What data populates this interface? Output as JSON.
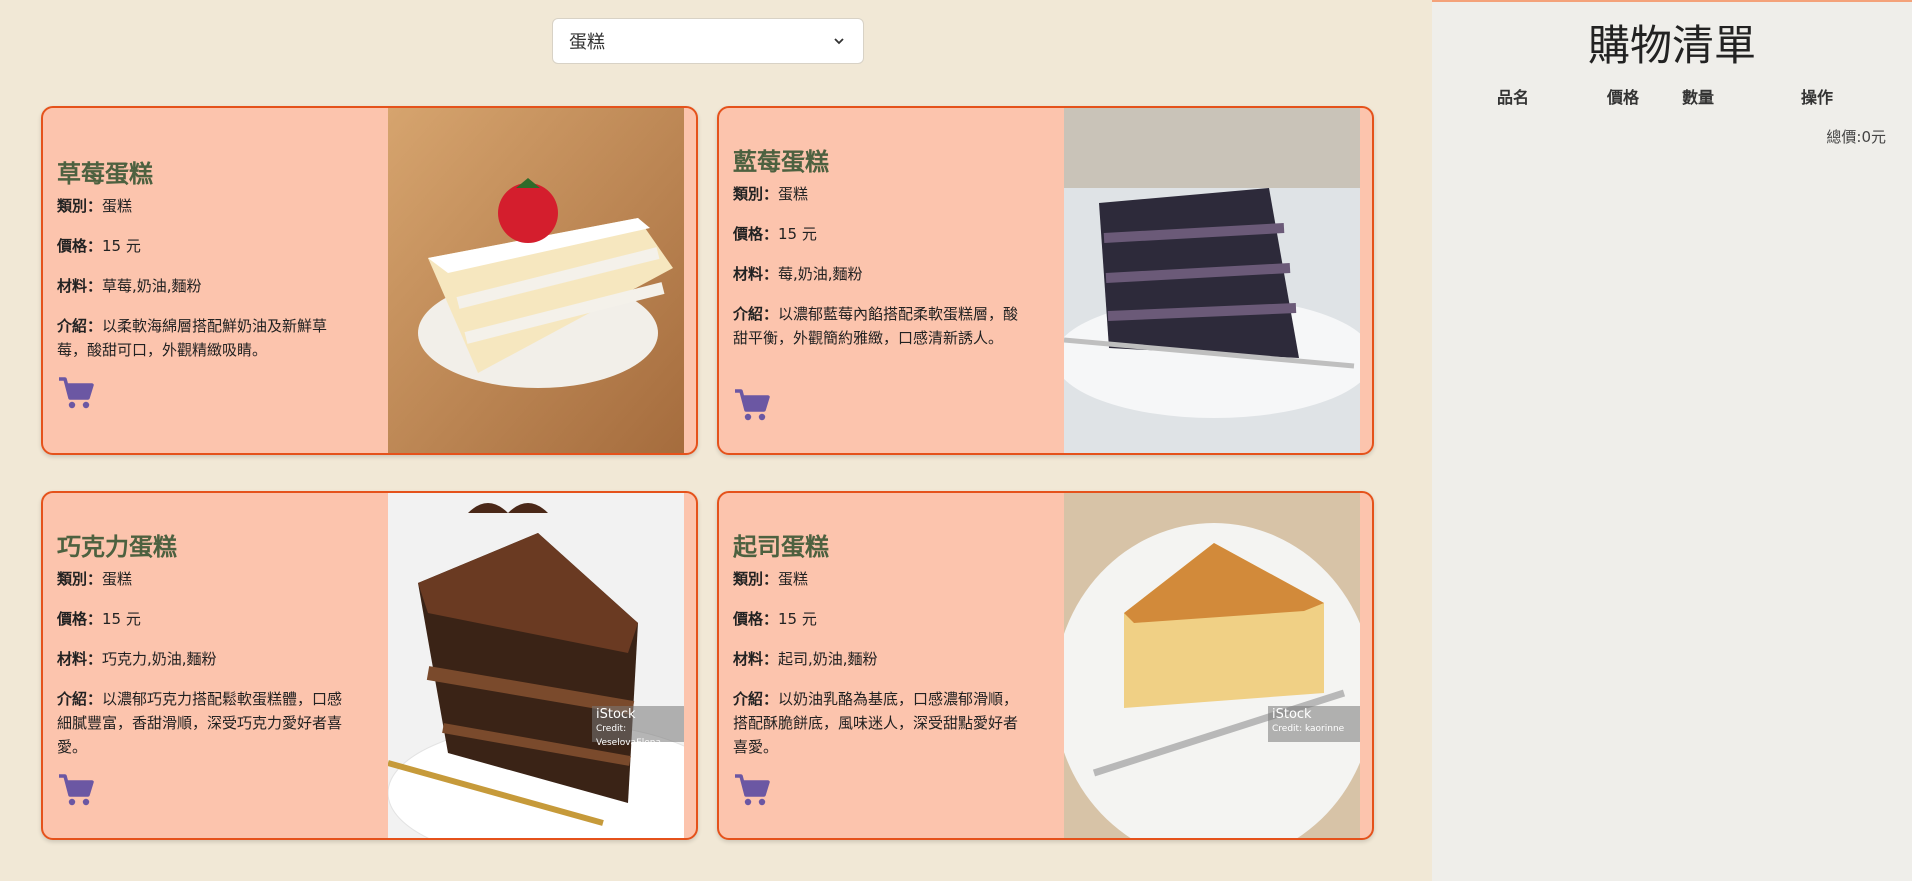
{
  "filter": {
    "selected": "蛋糕"
  },
  "labels": {
    "category": "類別：",
    "price": "價格：",
    "ingredients": "材料：",
    "intro": "介紹："
  },
  "products": [
    {
      "name": "草莓蛋糕",
      "category": "蛋糕",
      "price": "15 元",
      "ingredients": "草莓,奶油,麵粉",
      "intro": "以柔軟海綿層搭配鮮奶油及新鮮草莓，酸甜可口，外觀精緻吸睛。",
      "cart_icon": "cart-icon"
    },
    {
      "name": "藍莓蛋糕",
      "category": "蛋糕",
      "price": "15 元",
      "ingredients": "莓,奶油,麵粉",
      "intro": "以濃郁藍莓內餡搭配柔軟蛋糕層，酸甜平衡，外觀簡約雅緻，口感清新誘人。",
      "cart_icon": "cart-icon"
    },
    {
      "name": "巧克力蛋糕",
      "category": "蛋糕",
      "price": "15 元",
      "ingredients": "巧克力,奶油,麵粉",
      "intro": "以濃郁巧克力搭配鬆軟蛋糕體，口感細膩豐富，香甜滑順，深受巧克力愛好者喜愛。",
      "cart_icon": "cart-icon",
      "watermark": {
        "brand": "iStock",
        "credit": "Credit: VeselovaElena"
      }
    },
    {
      "name": "起司蛋糕",
      "category": "蛋糕",
      "price": "15 元",
      "ingredients": "起司,奶油,麵粉",
      "intro": "以奶油乳酪為基底，口感濃郁滑順，搭配酥脆餅底，風味迷人，深受甜點愛好者喜愛。",
      "cart_icon": "cart-icon",
      "watermark": {
        "brand": "iStock",
        "credit": "Credit: kaorinne"
      }
    }
  ],
  "cart": {
    "title": "購物清單",
    "columns": [
      "品名",
      "價格",
      "數量",
      "操作"
    ],
    "total": "總價:0元"
  },
  "colors": {
    "card_bg": "#fcc4ad",
    "card_border": "#e5521b",
    "title_green": "#4d6140",
    "cart_purple": "#6b57a3"
  }
}
